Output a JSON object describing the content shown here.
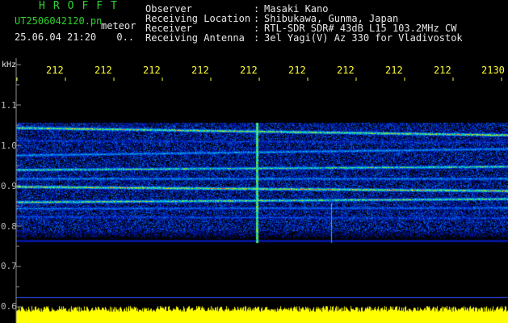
{
  "header": {
    "app_title": "HROFFT",
    "file_name": "UT2506042120.pn",
    "file_suffix": "meteor",
    "timestamp": "25.06.04 21:20",
    "status": "0.."
  },
  "info": [
    {
      "label": "Observer",
      "value": "Masaki Kano"
    },
    {
      "label": "Receiving Location",
      "value": "Shibukawa, Gunma, Japan"
    },
    {
      "label": "Receiver",
      "value": "RTL-SDR SDR# 43dB L15 103.2MHz CW"
    },
    {
      "label": "Receiving Antenna",
      "value": "3el Yagi(V) Az 330 for Vladivostok"
    }
  ],
  "freq_axis": {
    "unit": "kHz",
    "labels": [
      "1.1",
      "1.0",
      "0.9",
      "0.8",
      "0.7",
      "0.6"
    ]
  },
  "time_axis": {
    "labels": [
      "212",
      "212",
      "212",
      "212",
      "212",
      "212",
      "212",
      "212",
      "212",
      "2130"
    ]
  },
  "colors": {
    "info_text": "#e8e8e8",
    "title_green": "#2fd22f",
    "time_yellow": "#ffff33",
    "noise_yellow": "#ffff00",
    "band_blue": "#1030c8"
  }
}
